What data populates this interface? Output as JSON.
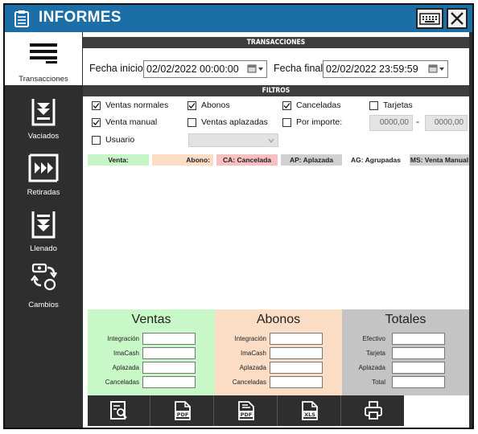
{
  "window": {
    "title": "INFORMES"
  },
  "sidebar": {
    "items": [
      {
        "label": "Transacciones",
        "icon": "menu-lines-icon",
        "active": true
      },
      {
        "label": "Vaciados",
        "icon": "funnel-down-icon",
        "active": false
      },
      {
        "label": "Retiradas",
        "icon": "fast-forward-icon",
        "active": false
      },
      {
        "label": "Llenado",
        "icon": "fill-down-icon",
        "active": false
      },
      {
        "label": "Cambios",
        "icon": "exchange-icon",
        "active": false
      }
    ]
  },
  "transacciones": {
    "header": "TRANSACCIONES",
    "fecha_inicio_label": "Fecha inicio",
    "fecha_inicio_value": "02/02/2022 00:00:00",
    "fecha_final_label": "Fecha final",
    "fecha_final_value": "02/02/2022 23:59:59"
  },
  "filtros": {
    "header": "FILTROS",
    "ventas_normales": {
      "label": "Ventas normales",
      "checked": true
    },
    "abonos": {
      "label": "Abonos",
      "checked": true
    },
    "canceladas": {
      "label": "Canceladas",
      "checked": true
    },
    "tarjetas": {
      "label": "Tarjetas",
      "checked": false
    },
    "venta_manual": {
      "label": "Venta manual",
      "checked": true
    },
    "ventas_aplazadas": {
      "label": "Ventas aplazadas",
      "checked": false
    },
    "por_importe": {
      "label": "Por importe:",
      "checked": false
    },
    "usuario": {
      "label": "Usuario",
      "checked": false
    },
    "importe_min": "0000,00",
    "importe_sep": "-",
    "importe_max": "0000,00"
  },
  "legend": {
    "venta": "Venta:",
    "abono": "Abono:",
    "cancelada": "CA: Cancelada",
    "aplazada": "AP: Aplazada",
    "agrupadas": "AG: Agrupadas",
    "manual": "MS: Venta Manual",
    "colors": {
      "venta": "#c6f5c6",
      "abono": "#fcdcc4",
      "cancelada": "#f8c0c0",
      "aplazada": "#d0d0d0",
      "agrupadas": "#ffffff",
      "manual": "#d0d0d0"
    }
  },
  "summary": {
    "ventas": {
      "title": "Ventas",
      "rows": [
        "Integración",
        "ImaCash",
        "Aplazada",
        "Canceladas"
      ],
      "color": "#c8f8c8"
    },
    "abonos": {
      "title": "Abonos",
      "rows": [
        "Integración",
        "ImaCash",
        "Aplazada",
        "Canceladas"
      ],
      "color": "#fbdcc4"
    },
    "totales": {
      "title": "Totales",
      "rows": [
        "Efectivo",
        "Tarjeta",
        "Aplazada",
        "Total"
      ],
      "color": "#c4c4c4"
    }
  },
  "toolbar": {
    "buttons": [
      {
        "icon": "search-report-icon"
      },
      {
        "icon": "pdf-icon",
        "text": "PDF"
      },
      {
        "icon": "pdf-list-icon",
        "text": "PDF"
      },
      {
        "icon": "xls-icon",
        "text": "XLS"
      },
      {
        "icon": "printer-icon"
      }
    ]
  }
}
